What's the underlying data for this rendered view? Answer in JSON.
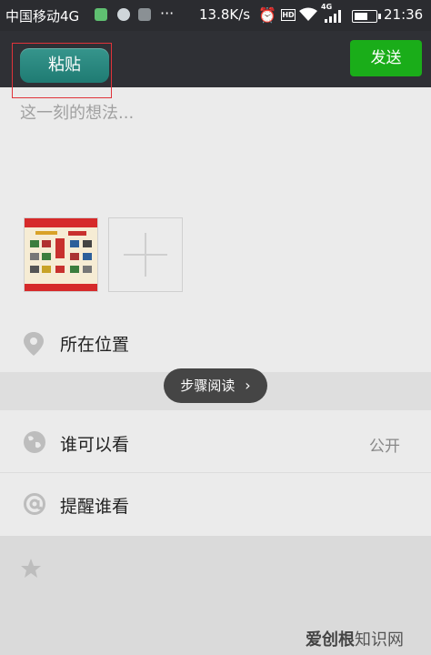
{
  "status_bar": {
    "carrier": "中国移动4G",
    "dots": "···",
    "speed": "13.8K/s",
    "hd": "HD",
    "network": "4G",
    "time": "21:36"
  },
  "toolbar": {
    "paste_label": "粘贴",
    "send_label": "发送"
  },
  "compose": {
    "placeholder": "这一刻的想法..."
  },
  "rows": {
    "location_label": "所在位置",
    "visibility_label": "谁可以看",
    "visibility_value": "公开",
    "mention_label": "提醒谁看"
  },
  "toast": {
    "label": "步骤阅读",
    "arrow": "›"
  },
  "watermark": {
    "brand": "爱创根",
    "site": "知识网"
  },
  "colors": {
    "send_green": "#1aad19",
    "paste_teal": "#268a81",
    "highlight_red": "#e0333a"
  }
}
